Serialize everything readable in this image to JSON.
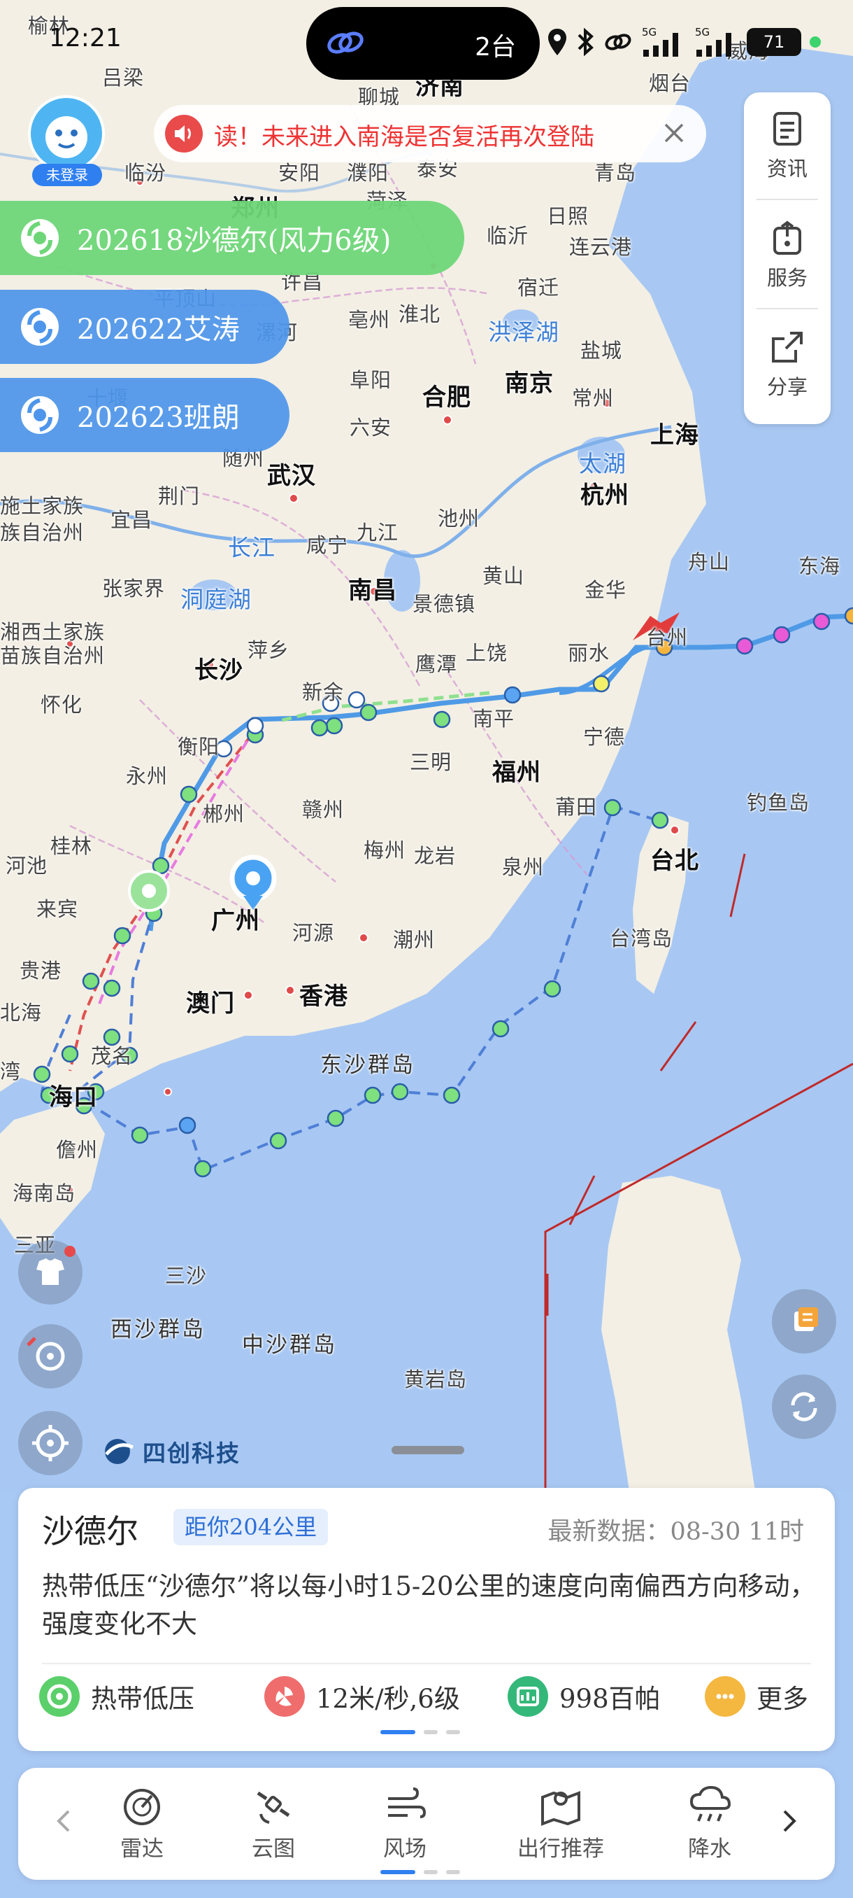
{
  "status_bar": {
    "time": "12:21",
    "pill_count": "2台",
    "battery": "71",
    "network1": "5G",
    "network2": "5G"
  },
  "avatar": {
    "label": "未登录"
  },
  "notice": {
    "text": "读！未来进入南海是否复活再次登陆"
  },
  "side_panel": {
    "items": [
      {
        "label": "资讯",
        "icon": "news-icon"
      },
      {
        "label": "服务",
        "icon": "service-icon"
      },
      {
        "label": "分享",
        "icon": "share-icon"
      }
    ]
  },
  "typhoons": [
    {
      "label": "202618沙德尔(风力6级)",
      "active": true,
      "color": "#6ed678"
    },
    {
      "label": "202622艾涛",
      "active": false,
      "color": "#4d96eb"
    },
    {
      "label": "202623班朗",
      "active": false,
      "color": "#4d96eb"
    }
  ],
  "map": {
    "labels": [
      {
        "id": "yulin",
        "text": "榆林"
      },
      {
        "id": "lvliang",
        "text": "吕梁"
      },
      {
        "id": "jinan",
        "text": "济南"
      },
      {
        "id": "liaocheng",
        "text": "聊城"
      },
      {
        "id": "yantai",
        "text": "烟台"
      },
      {
        "id": "weihai",
        "text": "威海"
      },
      {
        "id": "linfen",
        "text": "临汾"
      },
      {
        "id": "anyang",
        "text": "安阳"
      },
      {
        "id": "puyang",
        "text": "濮阳"
      },
      {
        "id": "taian",
        "text": "泰安"
      },
      {
        "id": "qingdao",
        "text": "青岛"
      },
      {
        "id": "zhengzhou",
        "text": "郑州"
      },
      {
        "id": "heze",
        "text": "菏泽"
      },
      {
        "id": "rizhao",
        "text": "日照"
      },
      {
        "id": "linyi",
        "text": "临沂"
      },
      {
        "id": "lianyungang",
        "text": "连云港"
      },
      {
        "id": "xuchang",
        "text": "许昌"
      },
      {
        "id": "suqian",
        "text": "宿迁"
      },
      {
        "id": "pingdingshan",
        "text": "平顶山"
      },
      {
        "id": "bozhou",
        "text": "亳州"
      },
      {
        "id": "huaibei",
        "text": "淮北"
      },
      {
        "id": "hongzehu",
        "text": "洪泽湖"
      },
      {
        "id": "yancheng",
        "text": "盐城"
      },
      {
        "id": "luohe",
        "text": "漯河"
      },
      {
        "id": "nanjing",
        "text": "南京"
      },
      {
        "id": "changzhou",
        "text": "常州"
      },
      {
        "id": "shiyan",
        "text": "十堰"
      },
      {
        "id": "fuyang",
        "text": "阜阳"
      },
      {
        "id": "hefei",
        "text": "合肥"
      },
      {
        "id": "liuan",
        "text": "六安"
      },
      {
        "id": "shanghai",
        "text": "上海"
      },
      {
        "id": "taihu",
        "text": "太湖"
      },
      {
        "id": "suizhou",
        "text": "随州"
      },
      {
        "id": "wuhan",
        "text": "武汉"
      },
      {
        "id": "hangzhou",
        "text": "杭州"
      },
      {
        "id": "jingmen",
        "text": "荆门"
      },
      {
        "id": "jiujiang",
        "text": "九江"
      },
      {
        "id": "chizhou",
        "text": "池州"
      },
      {
        "id": "enshi1",
        "text": "施土家族"
      },
      {
        "id": "enshi2",
        "text": "族自治州"
      },
      {
        "id": "yichang",
        "text": "宜昌"
      },
      {
        "id": "changjiang",
        "text": "长江"
      },
      {
        "id": "xianning",
        "text": "咸宁"
      },
      {
        "id": "huangshan",
        "text": "黄山"
      },
      {
        "id": "zhoushan",
        "text": "舟山"
      },
      {
        "id": "donghai",
        "text": "东海"
      },
      {
        "id": "zhangjiajie",
        "text": "张家界"
      },
      {
        "id": "dongtinghu",
        "text": "洞庭湖"
      },
      {
        "id": "nanchang",
        "text": "南昌"
      },
      {
        "id": "jingdezhen",
        "text": "景德镇"
      },
      {
        "id": "jinhua",
        "text": "金华"
      },
      {
        "id": "xiangxi1",
        "text": "湘西土家族"
      },
      {
        "id": "xiangxi2",
        "text": "苗族自治州"
      },
      {
        "id": "pingxiang",
        "text": "萍乡"
      },
      {
        "id": "yingtan",
        "text": "鹰潭"
      },
      {
        "id": "shangrao",
        "text": "上饶"
      },
      {
        "id": "lishui",
        "text": "丽水"
      },
      {
        "id": "taizhou",
        "text": "台州"
      },
      {
        "id": "changsha",
        "text": "长沙"
      },
      {
        "id": "huaihua",
        "text": "怀化"
      },
      {
        "id": "xinyu",
        "text": "新余"
      },
      {
        "id": "nanping",
        "text": "南平"
      },
      {
        "id": "hengyang",
        "text": "衡阳"
      },
      {
        "id": "sanming",
        "text": "三明"
      },
      {
        "id": "ningde",
        "text": "宁德"
      },
      {
        "id": "yongzhou",
        "text": "永州"
      },
      {
        "id": "fuzhou",
        "text": "福州"
      },
      {
        "id": "chenzhou",
        "text": "郴州"
      },
      {
        "id": "ganzhou",
        "text": "赣州"
      },
      {
        "id": "putian",
        "text": "莆田"
      },
      {
        "id": "diaoyudao",
        "text": "钓鱼岛"
      },
      {
        "id": "guilin",
        "text": "桂林"
      },
      {
        "id": "meizhou",
        "text": "梅州"
      },
      {
        "id": "longyan",
        "text": "龙岩"
      },
      {
        "id": "hechi",
        "text": "河池"
      },
      {
        "id": "quanzhou",
        "text": "泉州"
      },
      {
        "id": "taibei",
        "text": "台北"
      },
      {
        "id": "laibin",
        "text": "来宾"
      },
      {
        "id": "guangzhou",
        "text": "广州"
      },
      {
        "id": "heyuan",
        "text": "河源"
      },
      {
        "id": "taiwandao",
        "text": "台湾岛"
      },
      {
        "id": "chaozhou",
        "text": "潮州"
      },
      {
        "id": "guigang",
        "text": "贵港"
      },
      {
        "id": "aomen",
        "text": "澳门"
      },
      {
        "id": "xianggang",
        "text": "香港"
      },
      {
        "id": "beihai",
        "text": "北海"
      },
      {
        "id": "maoming",
        "text": "茂名"
      },
      {
        "id": "dongsha",
        "text": "东沙群岛"
      },
      {
        "id": "wan",
        "text": "湾"
      },
      {
        "id": "haikou",
        "text": "海口"
      },
      {
        "id": "danzhou",
        "text": "儋州"
      },
      {
        "id": "hainandao",
        "text": "海南岛"
      },
      {
        "id": "sanya",
        "text": "三亚"
      },
      {
        "id": "sansha",
        "text": "三沙"
      },
      {
        "id": "xisha",
        "text": "西沙群岛"
      },
      {
        "id": "zhongsha",
        "text": "中沙群岛"
      },
      {
        "id": "huangyandao",
        "text": "黄岩岛"
      }
    ]
  },
  "map_tools": {
    "layers": "layers-icon",
    "locate": "locate-icon",
    "refresh": "refresh-icon",
    "clothes": "clothes-icon",
    "compass": "compass-icon",
    "target": "target-icon"
  },
  "logo": {
    "text": "四创科技"
  },
  "card": {
    "name": "沙德尔",
    "distance": "距你204公里",
    "latest": "最新数据：08-30 11时",
    "description": "热带低压“沙德尔”将以每小时15-20公里的速度向南偏西方向移动，强度变化不大",
    "stats": [
      {
        "label": "热带低压",
        "icon": "typhoon-level-icon",
        "color": "#5bcf6a"
      },
      {
        "label": "12米/秒,6级",
        "icon": "wind-speed-icon",
        "color": "#ef6d6d"
      },
      {
        "label": "998百帕",
        "icon": "pressure-icon",
        "color": "#34b87a"
      },
      {
        "label": "更多",
        "icon": "more-icon",
        "color": "#f4b740"
      }
    ]
  },
  "bottom_nav": {
    "items": [
      {
        "label": "雷达",
        "icon": "radar-icon"
      },
      {
        "label": "云图",
        "icon": "satellite-icon"
      },
      {
        "label": "风场",
        "icon": "wind-field-icon"
      },
      {
        "label": "出行推荐",
        "icon": "travel-map-icon"
      },
      {
        "label": "降水",
        "icon": "rain-icon"
      }
    ],
    "accent": "#2f7ff0"
  }
}
